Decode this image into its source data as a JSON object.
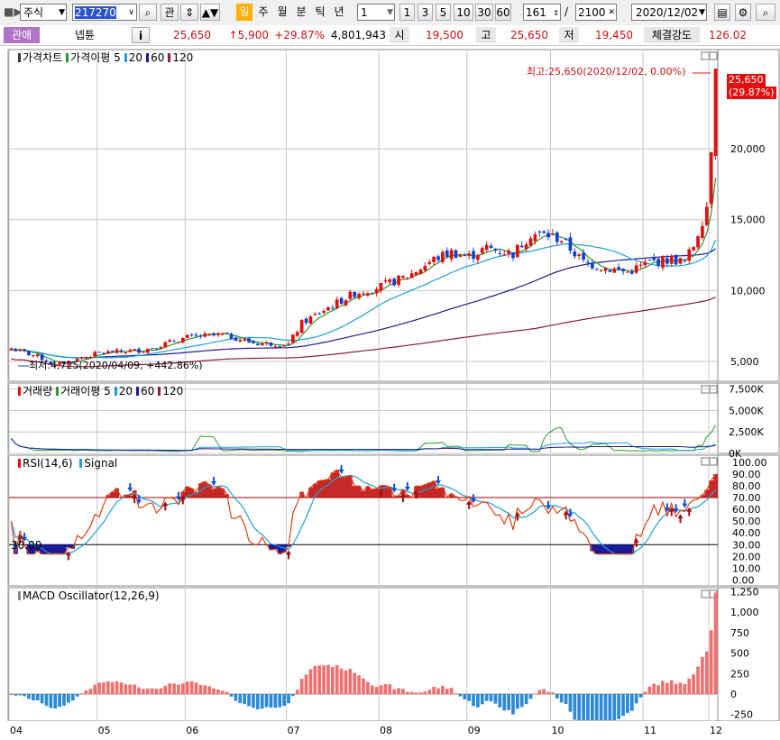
{
  "toolbar": {
    "market": "주식",
    "code": "217270",
    "btn_gwan": "관",
    "periods": [
      "일",
      "주",
      "월",
      "분",
      "틱",
      "년"
    ],
    "interval_value": "1",
    "interval_presets": [
      "1",
      "3",
      "5",
      "10",
      "30",
      "60"
    ],
    "count_shown": "161",
    "count_total": "2100",
    "date": "2020/12/02"
  },
  "info": {
    "tag": "관애",
    "name": "넵튠",
    "i_btn": "i",
    "price": "25,650",
    "change": "↑5,900",
    "change_pct": "+29.87%",
    "volume": "4,801,943",
    "open_label": "시",
    "open": "19,500",
    "high_label": "고",
    "high": "25,650",
    "low_label": "저",
    "low": "19,450",
    "strength_label": "체결강도",
    "strength": "126.02"
  },
  "colors": {
    "up": "#e01010",
    "down": "#1040d0",
    "ma5": "#2a9a2a",
    "ma20": "#1fa0d8",
    "ma60": "#1c1c8c",
    "ma120": "#8c1c4c",
    "grid": "#c8c8c8",
    "axis_bg": "#ffffff"
  },
  "price_panel": {
    "title": "가격차트",
    "legend": [
      {
        "label": "가격이평 5",
        "color": "#2a9a2a"
      },
      {
        "label": "20",
        "color": "#1fa0d8"
      },
      {
        "label": "60",
        "color": "#1c1c8c"
      },
      {
        "label": "120",
        "color": "#8c1c4c"
      }
    ],
    "high_annot": "최고:25,650(2020/12/02, 0.00%)",
    "low_annot": "최저:4,725(2020/04/09, +442.86%)",
    "last_price": "25,650",
    "last_pct": "(29.87%)"
  },
  "volume_panel": {
    "title": "거래량",
    "legend": [
      {
        "label": "거래이평 5",
        "color": "#2a9a2a"
      },
      {
        "label": "20",
        "color": "#1fa0d8"
      },
      {
        "label": "60",
        "color": "#1c1c8c"
      },
      {
        "label": "120",
        "color": "#8c1c4c"
      }
    ]
  },
  "rsi_panel": {
    "title": "RSI(14,6)",
    "signal_label": "Signal",
    "level_label": "30.00"
  },
  "macd_panel": {
    "title": "MACD Oscillator(12,26,9)"
  },
  "chart_data": [
    {
      "type": "candlestick",
      "title": "가격차트",
      "x_months": [
        "04",
        "05",
        "06",
        "07",
        "08",
        "09",
        "10",
        "11",
        "12"
      ],
      "y_ticks": [
        5000,
        10000,
        15000,
        20000
      ],
      "y_tick_labels": [
        "5,000",
        "10,000",
        "15,000",
        "20,000"
      ],
      "ylim": [
        3600,
        27000
      ],
      "high": {
        "value": 25650,
        "date": "2020/12/02"
      },
      "low": {
        "value": 4725,
        "date": "2020/04/09"
      },
      "monthly_close_approx": [
        {
          "month": "04",
          "close": 5600
        },
        {
          "month": "05",
          "close": 5900
        },
        {
          "month": "06",
          "close": 6600
        },
        {
          "month": "07",
          "close": 6200
        },
        {
          "month": "08",
          "close": 10200
        },
        {
          "month": "09",
          "close": 12400
        },
        {
          "month": "10",
          "close": 13000
        },
        {
          "month": "11",
          "close": 11200
        },
        {
          "month": "12",
          "close": 25650
        }
      ]
    },
    {
      "type": "bar",
      "title": "거래량",
      "y_ticks": [
        0,
        2500,
        5000,
        7500
      ],
      "y_tick_labels": [
        "0K",
        "2,500K",
        "5,000K",
        "7,500K"
      ],
      "ylim": [
        0,
        8200
      ],
      "last_volume_k": 4802
    },
    {
      "type": "line",
      "title": "RSI(14,6)",
      "series": [
        {
          "name": "RSI(14,6)"
        },
        {
          "name": "Signal"
        }
      ],
      "y_ticks": [
        0,
        10,
        20,
        30,
        40,
        50,
        60,
        70,
        80,
        90,
        100
      ],
      "y_tick_labels": [
        "0.00",
        "10.00",
        "20.00",
        "30.00",
        "40.00",
        "50.00",
        "60.00",
        "70.00",
        "80.00",
        "90.00",
        "100.00"
      ],
      "ylim": [
        0,
        100
      ],
      "levels": [
        30,
        70
      ]
    },
    {
      "type": "bar",
      "title": "MACD Oscillator(12,26,9)",
      "y_ticks": [
        -250,
        0,
        250,
        500,
        750,
        1000,
        1250
      ],
      "y_tick_labels": [
        "-250",
        "0",
        "250",
        "500",
        "750",
        "1,000",
        "1,250"
      ],
      "ylim": [
        -330,
        1300
      ]
    }
  ]
}
